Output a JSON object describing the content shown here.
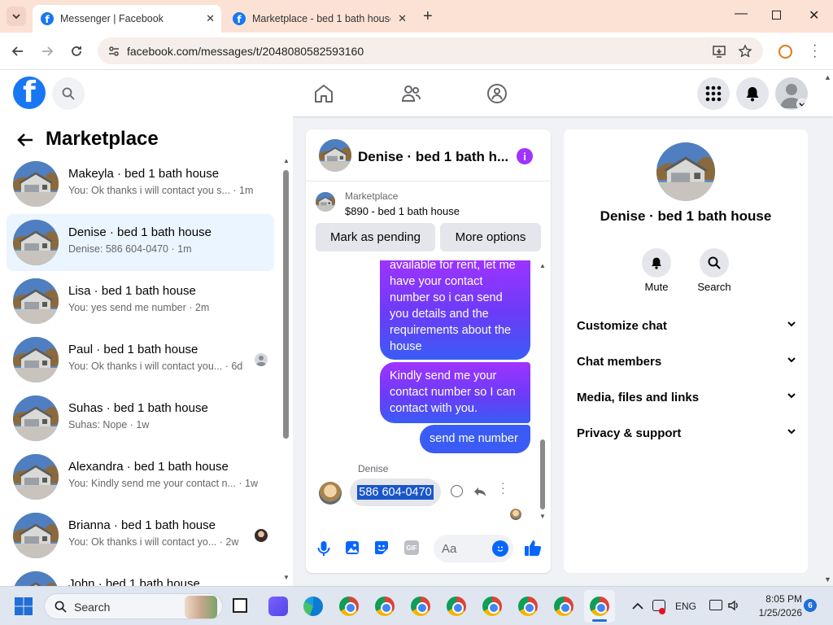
{
  "browser": {
    "tabs": [
      {
        "title": "Messenger | Facebook",
        "active": true
      },
      {
        "title": "Marketplace - bed 1 bath house",
        "active": false
      }
    ],
    "url": "facebook.com/messages/t/2048080582593160"
  },
  "left_panel": {
    "title": "Marketplace",
    "conversations": [
      {
        "name": "Makeyla · bed 1 bath house",
        "preview": "You: Ok thanks i will contact you s... · 1m",
        "selected": false
      },
      {
        "name": "Denise · bed 1 bath house",
        "preview": "Denise: 586 604-0470 · 1m",
        "selected": true
      },
      {
        "name": "Lisa · bed 1 bath house",
        "preview": "You: yes send me number · 2m",
        "selected": false
      },
      {
        "name": "Paul · bed 1 bath house",
        "preview": "You: Ok thanks i will contact you... · 6d",
        "selected": false
      },
      {
        "name": "Suhas · bed 1 bath house",
        "preview": "Suhas: Nope · 1w",
        "selected": false
      },
      {
        "name": "Alexandra · bed 1 bath house",
        "preview": "You: Kindly send me your contact n... · 1w",
        "selected": false
      },
      {
        "name": "Brianna · bed 1 bath house",
        "preview": "You: Ok thanks i will contact yo... · 2w",
        "selected": false
      },
      {
        "name": "John · bed 1 bath house",
        "preview": "",
        "selected": false
      }
    ]
  },
  "chat": {
    "header_title": "Denise · bed 1 bath h...",
    "listing_label": "Marketplace",
    "listing_title": "$890 - bed 1 bath house",
    "mark_pending": "Mark as pending",
    "more_options": "More options",
    "messages": [
      {
        "from": "me",
        "text": "available for rent, let me have your contact number so i can send you details and the requirements about the house"
      },
      {
        "from": "me",
        "text": "Kindly send me your contact number so I can contact with you."
      },
      {
        "from": "me",
        "text": "send me number"
      },
      {
        "from": "Denise",
        "sender_label": "Denise",
        "text": "586 604-0470"
      }
    ],
    "composer_placeholder": "Aa"
  },
  "info_panel": {
    "name": "Denise · bed 1 bath house",
    "mute_label": "Mute",
    "search_label": "Search",
    "sections": [
      "Customize chat",
      "Chat members",
      "Media, files and links",
      "Privacy & support"
    ]
  },
  "taskbar": {
    "search_label": "Search",
    "lang": "ENG",
    "time": "8:05 PM",
    "date": "1/25/2026",
    "notif_count": "6"
  },
  "colors": {
    "fb_blue": "#1877f2",
    "bubble_purple": "#a033ff",
    "bubble_blue": "#3a5cf5",
    "selected_conv": "#ebf5ff"
  }
}
